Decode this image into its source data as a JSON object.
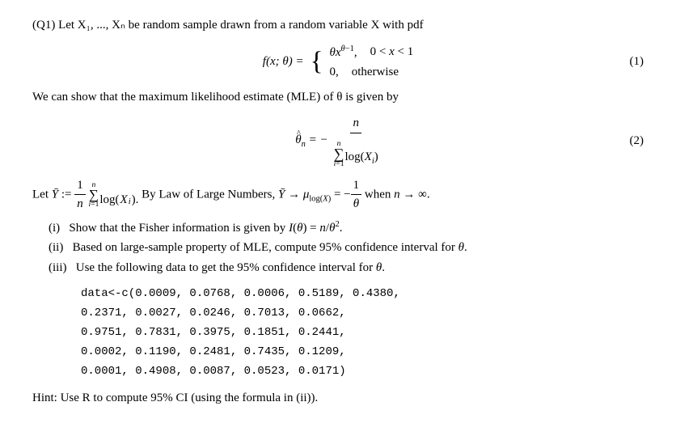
{
  "question": {
    "header": "(Q1) Let X₁, ..., Xₙ be random sample drawn from a random variable X with pdf",
    "pdf_label": "f(x; θ) =",
    "pdf_case1_expr": "θx^{θ−1},",
    "pdf_case1_condition": "0 < x < 1",
    "pdf_case2_expr": "0,",
    "pdf_case2_condition": "otherwise",
    "eq1_number": "(1)",
    "mle_text": "We can show that the maximum likelihood estimate (MLE) of θ is given by",
    "mle_eq_label": "θ̂ₙ = −",
    "mle_numerator": "n",
    "mle_denominator": "∑ⁿᵢ₌₁ log(Xᵢ)",
    "eq2_number": "(2)",
    "lln_text_1": "Let Ȳ := (1/n) ∑ⁿᵢ₌₁ log(Xᵢ). By Law of Large Numbers, Ȳ → μ_log(X) = −1/θ when n → ∞.",
    "part_i": "(i)  Show that the Fisher information is given by I(θ) = n/θ².",
    "part_ii": "(ii)  Based on large-sample property of MLE, compute 95% confidence interval for θ.",
    "part_iii": "(iii)  Use the following data to get the 95% confidence interval for θ.",
    "data_line1": "data<-c(0.0009,  0.0768,  0.0006,   0.5189,  0.4380,",
    "data_line2": "        0.2371,  0.0027,  0.0246,   0.7013,  0.0662,",
    "data_line3": "        0.9751,  0.7831,  0.3975,   0.1851,  0.2441,",
    "data_line4": "        0.0002,  0.1190,  0.2481,   0.7435,  0.1209,",
    "data_line5": "        0.0001,  0.4908,  0.0087,   0.0523,  0.0171)",
    "hint": "Hint: Use R to compute 95% CI (using the formula in (ii))."
  }
}
